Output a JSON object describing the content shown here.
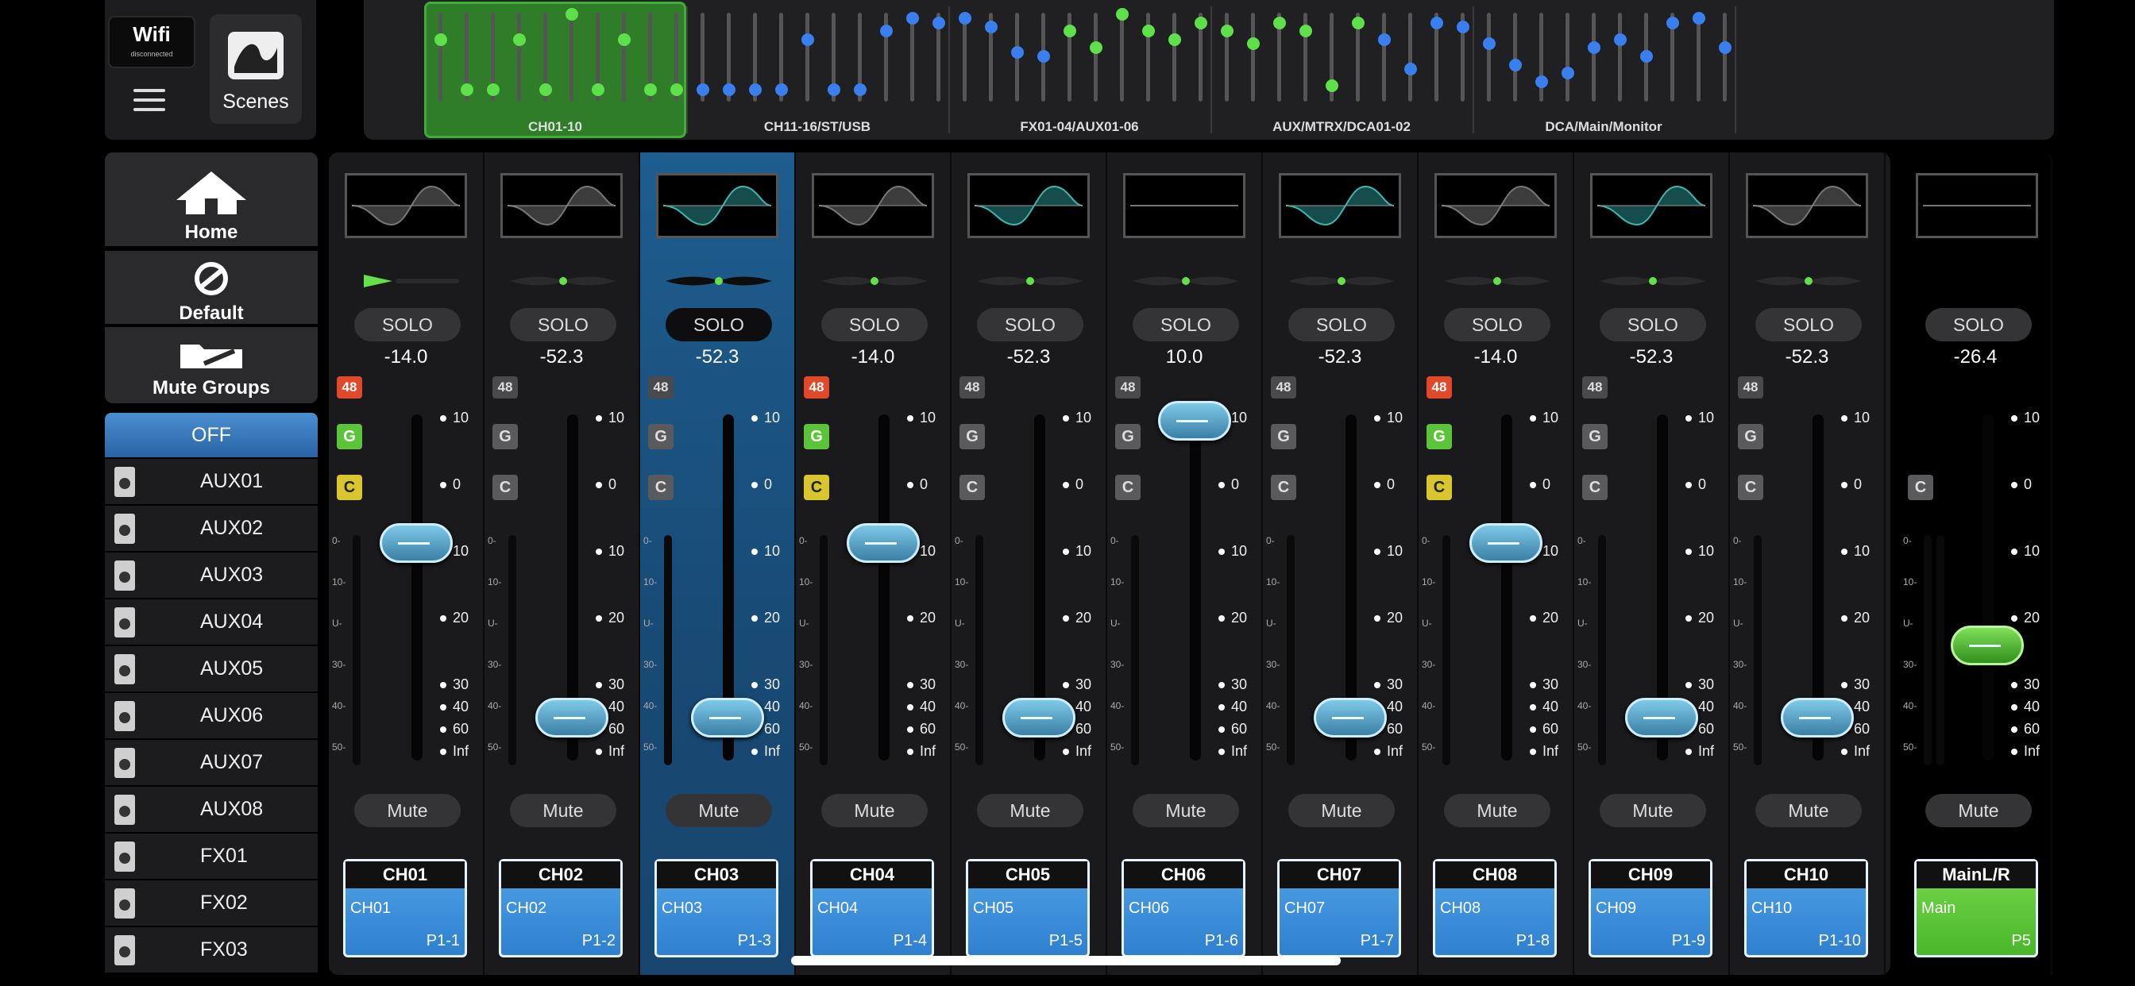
{
  "wifi": {
    "label": "Wifi",
    "status": "disconnected"
  },
  "scenes": {
    "label": "Scenes"
  },
  "overview": {
    "groups": [
      "CH01-10",
      "CH11-16/ST/USB",
      "FX01-04/AUX01-06",
      "AUX/MTRX/DCA01-02",
      "DCA/Main/Monitor"
    ]
  },
  "nav": {
    "home": "Home",
    "default": "Default",
    "mute_groups": "Mute Groups"
  },
  "sends": {
    "off": "OFF",
    "items": [
      "AUX01",
      "AUX02",
      "AUX03",
      "AUX04",
      "AUX05",
      "AUX06",
      "AUX07",
      "AUX08",
      "FX01",
      "FX02",
      "FX03"
    ]
  },
  "labels": {
    "solo": "SOLO",
    "mute": "Mute",
    "phantom": "48",
    "g": "G",
    "c": "C"
  },
  "scale": [
    "10",
    "0",
    "10",
    "20",
    "30",
    "40",
    "60",
    "Inf"
  ],
  "meter_scale": [
    "0-",
    "10-",
    "U-",
    "30-",
    "40-",
    "50-"
  ],
  "channels": [
    {
      "head": "CH01",
      "name": "CH01",
      "patch": "P1-1",
      "gain": "-14.0",
      "p48": true,
      "g": true,
      "c": true,
      "fader": 0.63
    },
    {
      "head": "CH02",
      "name": "CH02",
      "patch": "P1-2",
      "gain": "-52.3",
      "p48": false,
      "g": false,
      "c": false,
      "fader": 0.1
    },
    {
      "head": "CH03",
      "name": "CH03",
      "patch": "P1-3",
      "gain": "-52.3",
      "p48": false,
      "g": false,
      "c": false,
      "fader": 0.1
    },
    {
      "head": "CH04",
      "name": "CH04",
      "patch": "P1-4",
      "gain": "-14.0",
      "p48": true,
      "g": true,
      "c": true,
      "fader": 0.63
    },
    {
      "head": "CH05",
      "name": "CH05",
      "patch": "P1-5",
      "gain": "-52.3",
      "p48": false,
      "g": false,
      "c": false,
      "fader": 0.1
    },
    {
      "head": "CH06",
      "name": "CH06",
      "patch": "P1-6",
      "gain": "10.0",
      "p48": false,
      "g": false,
      "c": false,
      "fader": 1.0
    },
    {
      "head": "CH07",
      "name": "CH07",
      "patch": "P1-7",
      "gain": "-52.3",
      "p48": false,
      "g": false,
      "c": false,
      "fader": 0.1
    },
    {
      "head": "CH08",
      "name": "CH08",
      "patch": "P1-8",
      "gain": "-14.0",
      "p48": true,
      "g": true,
      "c": true,
      "fader": 0.63
    },
    {
      "head": "CH09",
      "name": "CH09",
      "patch": "P1-9",
      "gain": "-52.3",
      "p48": false,
      "g": false,
      "c": false,
      "fader": 0.1
    },
    {
      "head": "CH10",
      "name": "CH10",
      "patch": "P1-10",
      "gain": "-52.3",
      "p48": false,
      "g": false,
      "c": false,
      "fader": 0.1
    }
  ],
  "main": {
    "head": "MainL/R",
    "name": "Main",
    "patch": "P5",
    "gain": "-26.4",
    "fader": 0.32
  },
  "colors": {
    "accent": "#2f7fd0",
    "green": "#49b72a",
    "selected": "#1e5d8f"
  }
}
